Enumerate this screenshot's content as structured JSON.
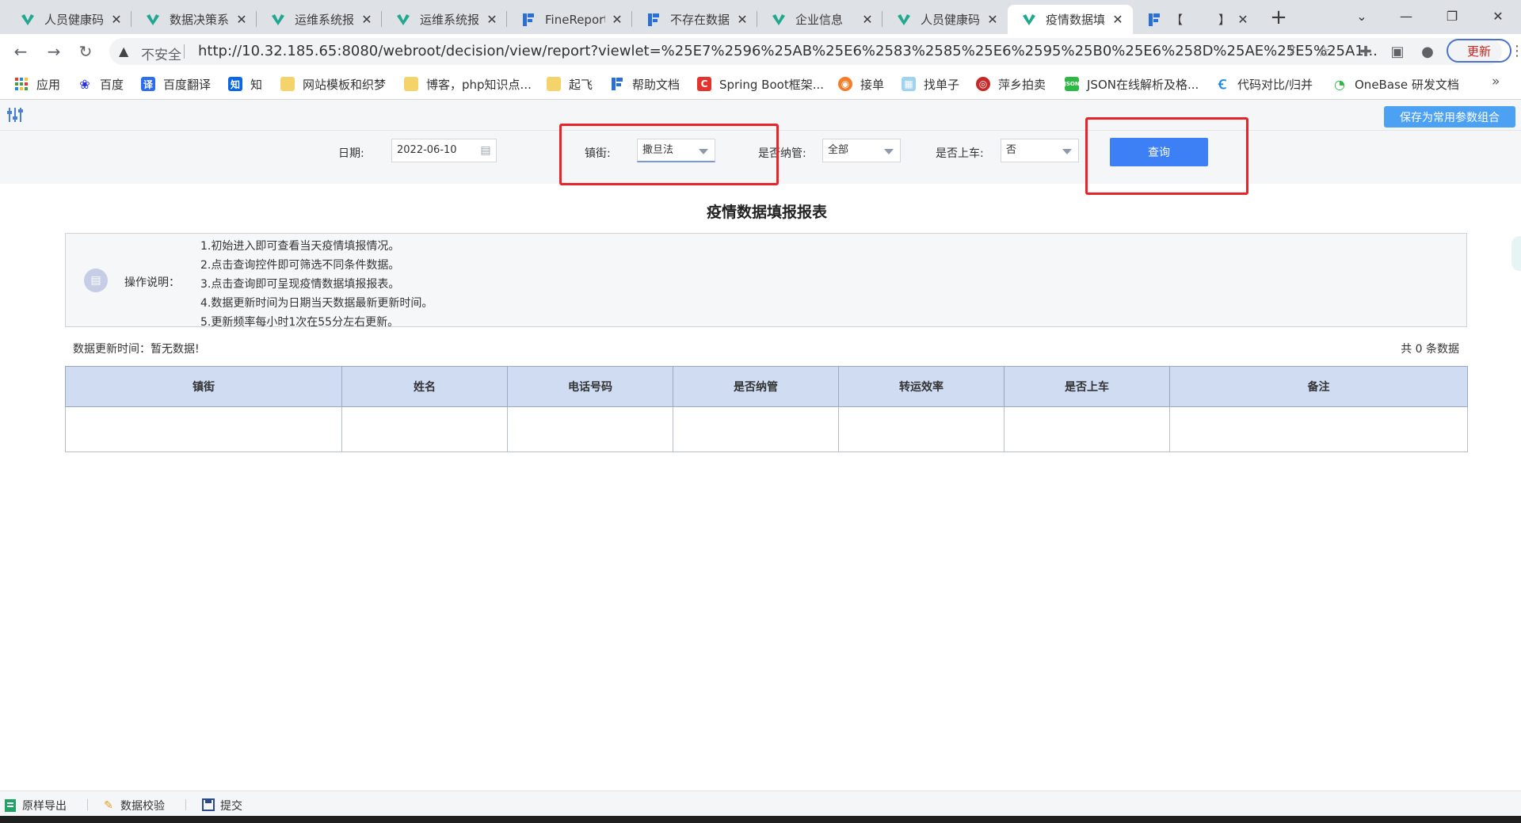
{
  "browser": {
    "tabs": [
      {
        "title": "人员健康码",
        "favicon": "fan-logo-icon",
        "active": false
      },
      {
        "title": "数据决策系",
        "favicon": "fan-logo-icon",
        "active": false
      },
      {
        "title": "运维系统报",
        "favicon": "fan-logo-icon",
        "active": false
      },
      {
        "title": "运维系统报",
        "favicon": "fan-logo-icon",
        "active": false
      },
      {
        "title": "FineReport",
        "favicon": "finereport-icon",
        "active": false
      },
      {
        "title": "不存在数据",
        "favicon": "finereport-icon",
        "active": false
      },
      {
        "title": "企业信息",
        "favicon": "fan-logo-icon",
        "active": false
      },
      {
        "title": "人员健康码",
        "favicon": "fan-logo-icon",
        "active": false
      },
      {
        "title": "疫情数据填",
        "favicon": "fan-logo-icon",
        "active": true
      },
      {
        "title": "【　　　】",
        "favicon": "finereport-icon",
        "active": false
      }
    ],
    "address": {
      "security_label": "不安全",
      "url": "http://10.32.185.65:8080/webroot/decision/view/report?viewlet=%25E7%2596%25AB%25E6%2583%2585%25E6%2595%25B0%25E6%258D%25AE%25E5%25A1..."
    },
    "update_label": "更新",
    "bookmarks": [
      {
        "label": "应用",
        "icon": "apps-grid-icon"
      },
      {
        "label": "百度",
        "icon": "baidu-paw-icon"
      },
      {
        "label": "百度翻译",
        "icon": "translate-icon"
      },
      {
        "label": "知",
        "icon": "zhihu-icon"
      },
      {
        "label": "网站模板和织梦",
        "icon": "folder-icon"
      },
      {
        "label": "博客，php知识点...",
        "icon": "folder-icon"
      },
      {
        "label": "起飞",
        "icon": "folder-icon"
      },
      {
        "label": "帮助文档",
        "icon": "finereport-icon"
      },
      {
        "label": "Spring Boot框架...",
        "icon": "csdn-icon"
      },
      {
        "label": "接单",
        "icon": "orange-circle-icon"
      },
      {
        "label": "找单子",
        "icon": "grid-app-icon"
      },
      {
        "label": "萍乡拍卖",
        "icon": "auction-icon"
      },
      {
        "label": "JSON在线解析及格...",
        "icon": "json-icon"
      },
      {
        "label": "代码对比/归并",
        "icon": "compare-icon"
      },
      {
        "label": "OneBase 研发文档",
        "icon": "onebase-icon"
      }
    ]
  },
  "report_toolbar": {
    "save_combo_label": "保存为常用参数组合"
  },
  "params": {
    "date_label": "日期:",
    "date_value": "2022-06-10",
    "street_label": "镇街:",
    "street_value": "撒旦法",
    "managed_label": "是否纳管:",
    "managed_value": "全部",
    "onboard_label": "是否上车:",
    "onboard_value": "否",
    "query_label": "查询"
  },
  "report": {
    "title": "疫情数据填报报表",
    "notes_label": "操作说明：",
    "notes": [
      "1.初始进入即可查看当天疫情填报情况。",
      "2.点击查询控件即可筛选不同条件数据。",
      "3.点击查询即可呈现疫情数据填报报表。",
      "4.数据更新时间为日期当天数据最新更新时间。",
      "5.更新频率每小时1次在55分左右更新。"
    ],
    "update_time": "数据更新时间：暂无数据!",
    "total": "共 0 条数据",
    "columns": [
      "镇街",
      "姓名",
      "电话号码",
      "是否纳管",
      "转运效率",
      "是否上车",
      "备注"
    ]
  },
  "bottombar": {
    "export_label": "原样导出",
    "validate_label": "数据校验",
    "submit_label": "提交"
  },
  "colors": {
    "accent": "#3d7ff5",
    "highlight": "#e8242a",
    "header_fill": "#cfdcf2"
  }
}
